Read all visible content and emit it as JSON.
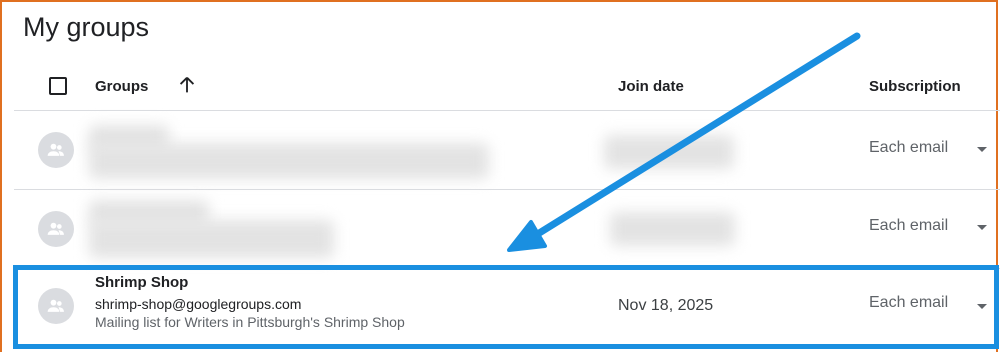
{
  "page_title": "My groups",
  "table": {
    "columns": {
      "groups": "Groups",
      "join_date": "Join date",
      "subscription": "Subscription"
    },
    "rows": [
      {
        "name": "",
        "email": "",
        "description": "",
        "join_date": "",
        "subscription": "Each email"
      },
      {
        "name": "",
        "email": "",
        "description": "",
        "join_date": "",
        "subscription": "Each email"
      },
      {
        "name": "Shrimp Shop",
        "email": "shrimp-shop@googlegroups.com",
        "description": "Mailing list for Writers in Pittsburgh's Shrimp Shop",
        "join_date": "Nov 18, 2025",
        "subscription": "Each email"
      }
    ]
  },
  "icons": {
    "sort": "arrow-up-icon",
    "avatar": "group-icon",
    "dropdown": "caret-down-icon"
  },
  "colors": {
    "highlight": "#1a8fe0",
    "frame": "#e07020",
    "avatar_bg": "#dadce0"
  }
}
